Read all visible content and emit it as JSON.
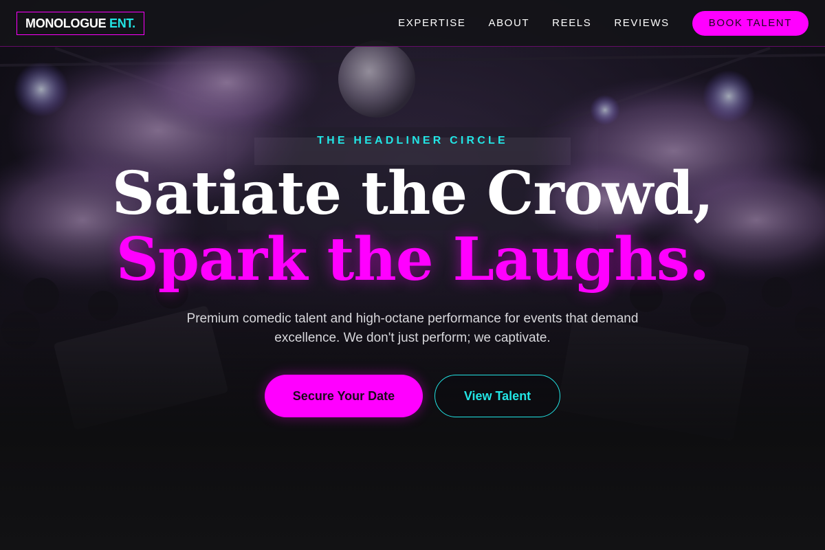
{
  "header": {
    "logo_main": "MONOLOGUE",
    "logo_accent": "ENT.",
    "nav": [
      {
        "label": "EXPERTISE"
      },
      {
        "label": "ABOUT"
      },
      {
        "label": "REELS"
      },
      {
        "label": "REVIEWS"
      }
    ],
    "cta_label": "BOOK TALENT"
  },
  "hero": {
    "eyebrow": "THE HEADLINER CIRCLE",
    "headline_line1": "Satiate the Crowd,",
    "headline_line2": "Spark the Laughs.",
    "subcopy": "Premium comedic talent and high-octane performance for events that demand excellence. We don't just perform; we captivate.",
    "primary_button": "Secure Your Date",
    "secondary_button": "View Talent"
  },
  "colors": {
    "accent_magenta": "#ff00ff",
    "accent_cyan": "#22e5e5",
    "background": "#121214"
  },
  "background_image": "nightclub-crowd-stage-photo"
}
